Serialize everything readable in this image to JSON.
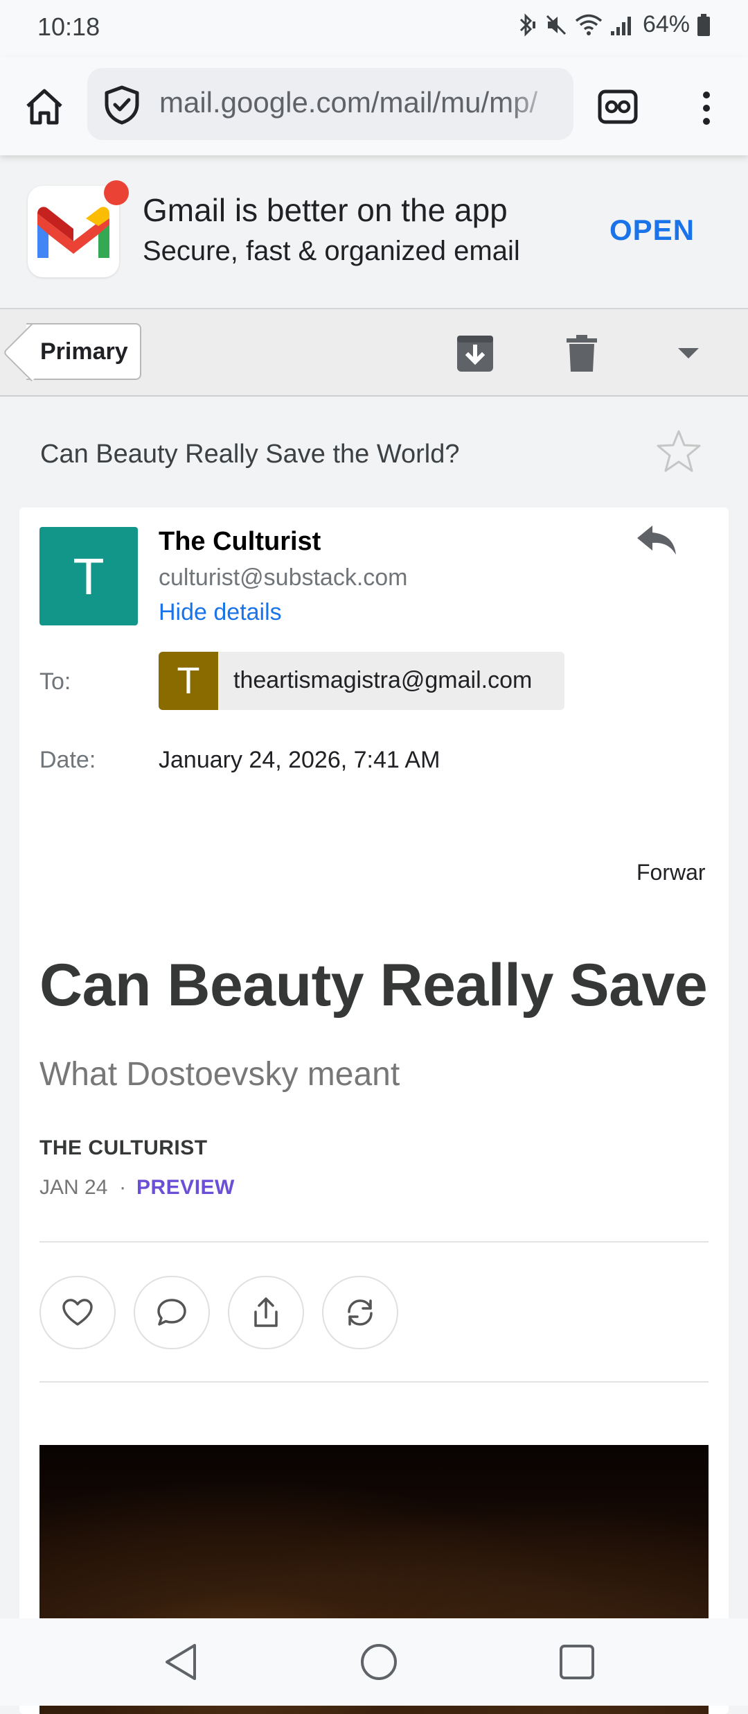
{
  "status_bar": {
    "time": "10:18",
    "battery": "64%"
  },
  "browser": {
    "url": "mail.google.com/mail/mu/mp/"
  },
  "promo": {
    "title": "Gmail is better on the app",
    "subtitle": "Secure, fast & organized email",
    "open_label": "OPEN"
  },
  "toolbar": {
    "back_label": "Primary"
  },
  "email": {
    "subject": "Can Beauty Really Save the World?",
    "sender_name": "The Culturist",
    "sender_avatar": "T",
    "sender_email": "culturist@substack.com",
    "hide_details": "Hide details",
    "to_label": "To:",
    "to_avatar": "T",
    "to_email": "theartismagistra@gmail.com",
    "date_label": "Date:",
    "date_value": "January 24, 2026, 7:41 AM",
    "forward_label": "Forwar"
  },
  "post": {
    "title": "Can Beauty Really Save",
    "subtitle": "What Dostoevsky meant",
    "publication": "THE CULTURIST",
    "date": "JAN 24",
    "separator": "∙",
    "preview": "PREVIEW"
  },
  "colors": {
    "sender_avatar": "#12968a",
    "to_avatar": "#8a6b00",
    "link_blue": "#1a73e8",
    "preview_purple": "#6b4fd6"
  }
}
